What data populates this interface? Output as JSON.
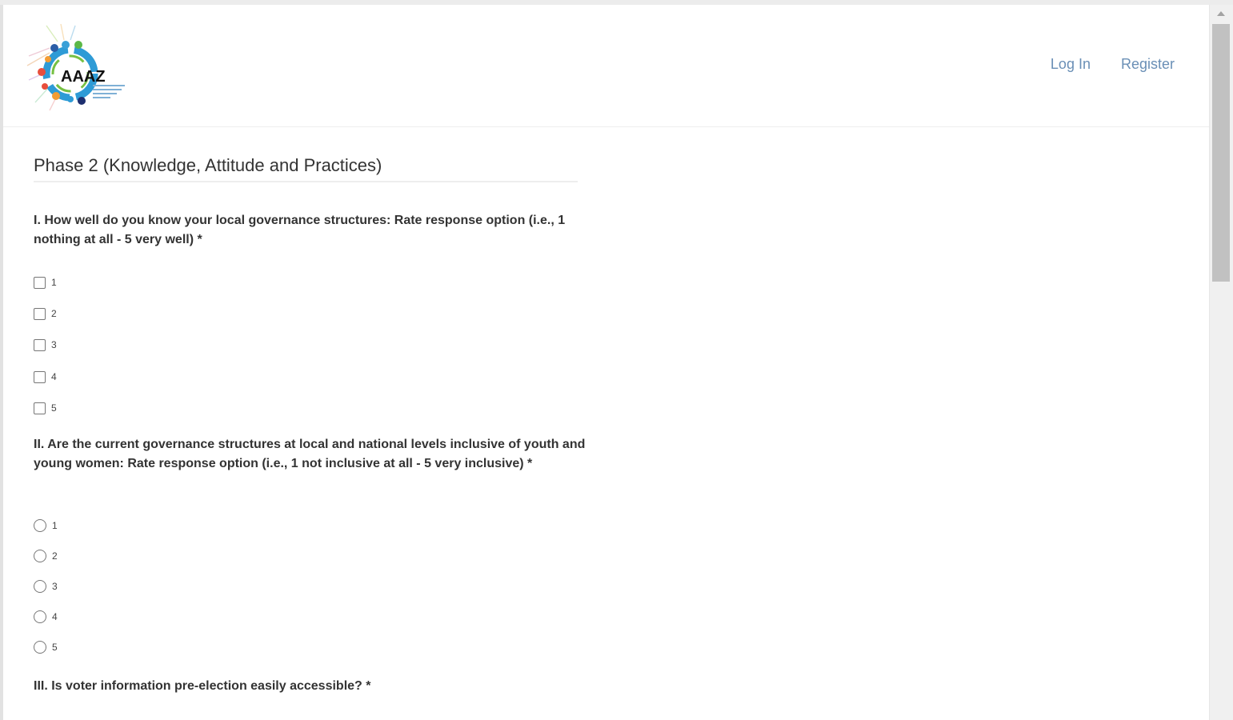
{
  "header": {
    "logo_text": "AAAZ",
    "nav": {
      "login": "Log In",
      "register": "Register"
    }
  },
  "form": {
    "title": "Phase 2 (Knowledge, Attitude and Practices)",
    "questions": [
      {
        "text": "I. How well do you know your local governance structures: Rate response option (i.e., 1 nothing at all - 5 very well) *",
        "type": "checkbox",
        "options": [
          "1",
          "2",
          "3",
          "4",
          "5"
        ]
      },
      {
        "text": "II. Are the current governance structures at local and national levels inclusive of youth and young women: Rate response option (i.e., 1 not inclusive at all - 5 very inclusive) *",
        "type": "radio",
        "options": [
          "1",
          "2",
          "3",
          "4",
          "5"
        ]
      },
      {
        "text": "III. Is voter information pre-election easily accessible? *",
        "type": "radio",
        "options": []
      }
    ]
  },
  "colors": {
    "link": "#6a8fb6",
    "text": "#333333",
    "scroll_thumb": "#c1c1c1"
  }
}
